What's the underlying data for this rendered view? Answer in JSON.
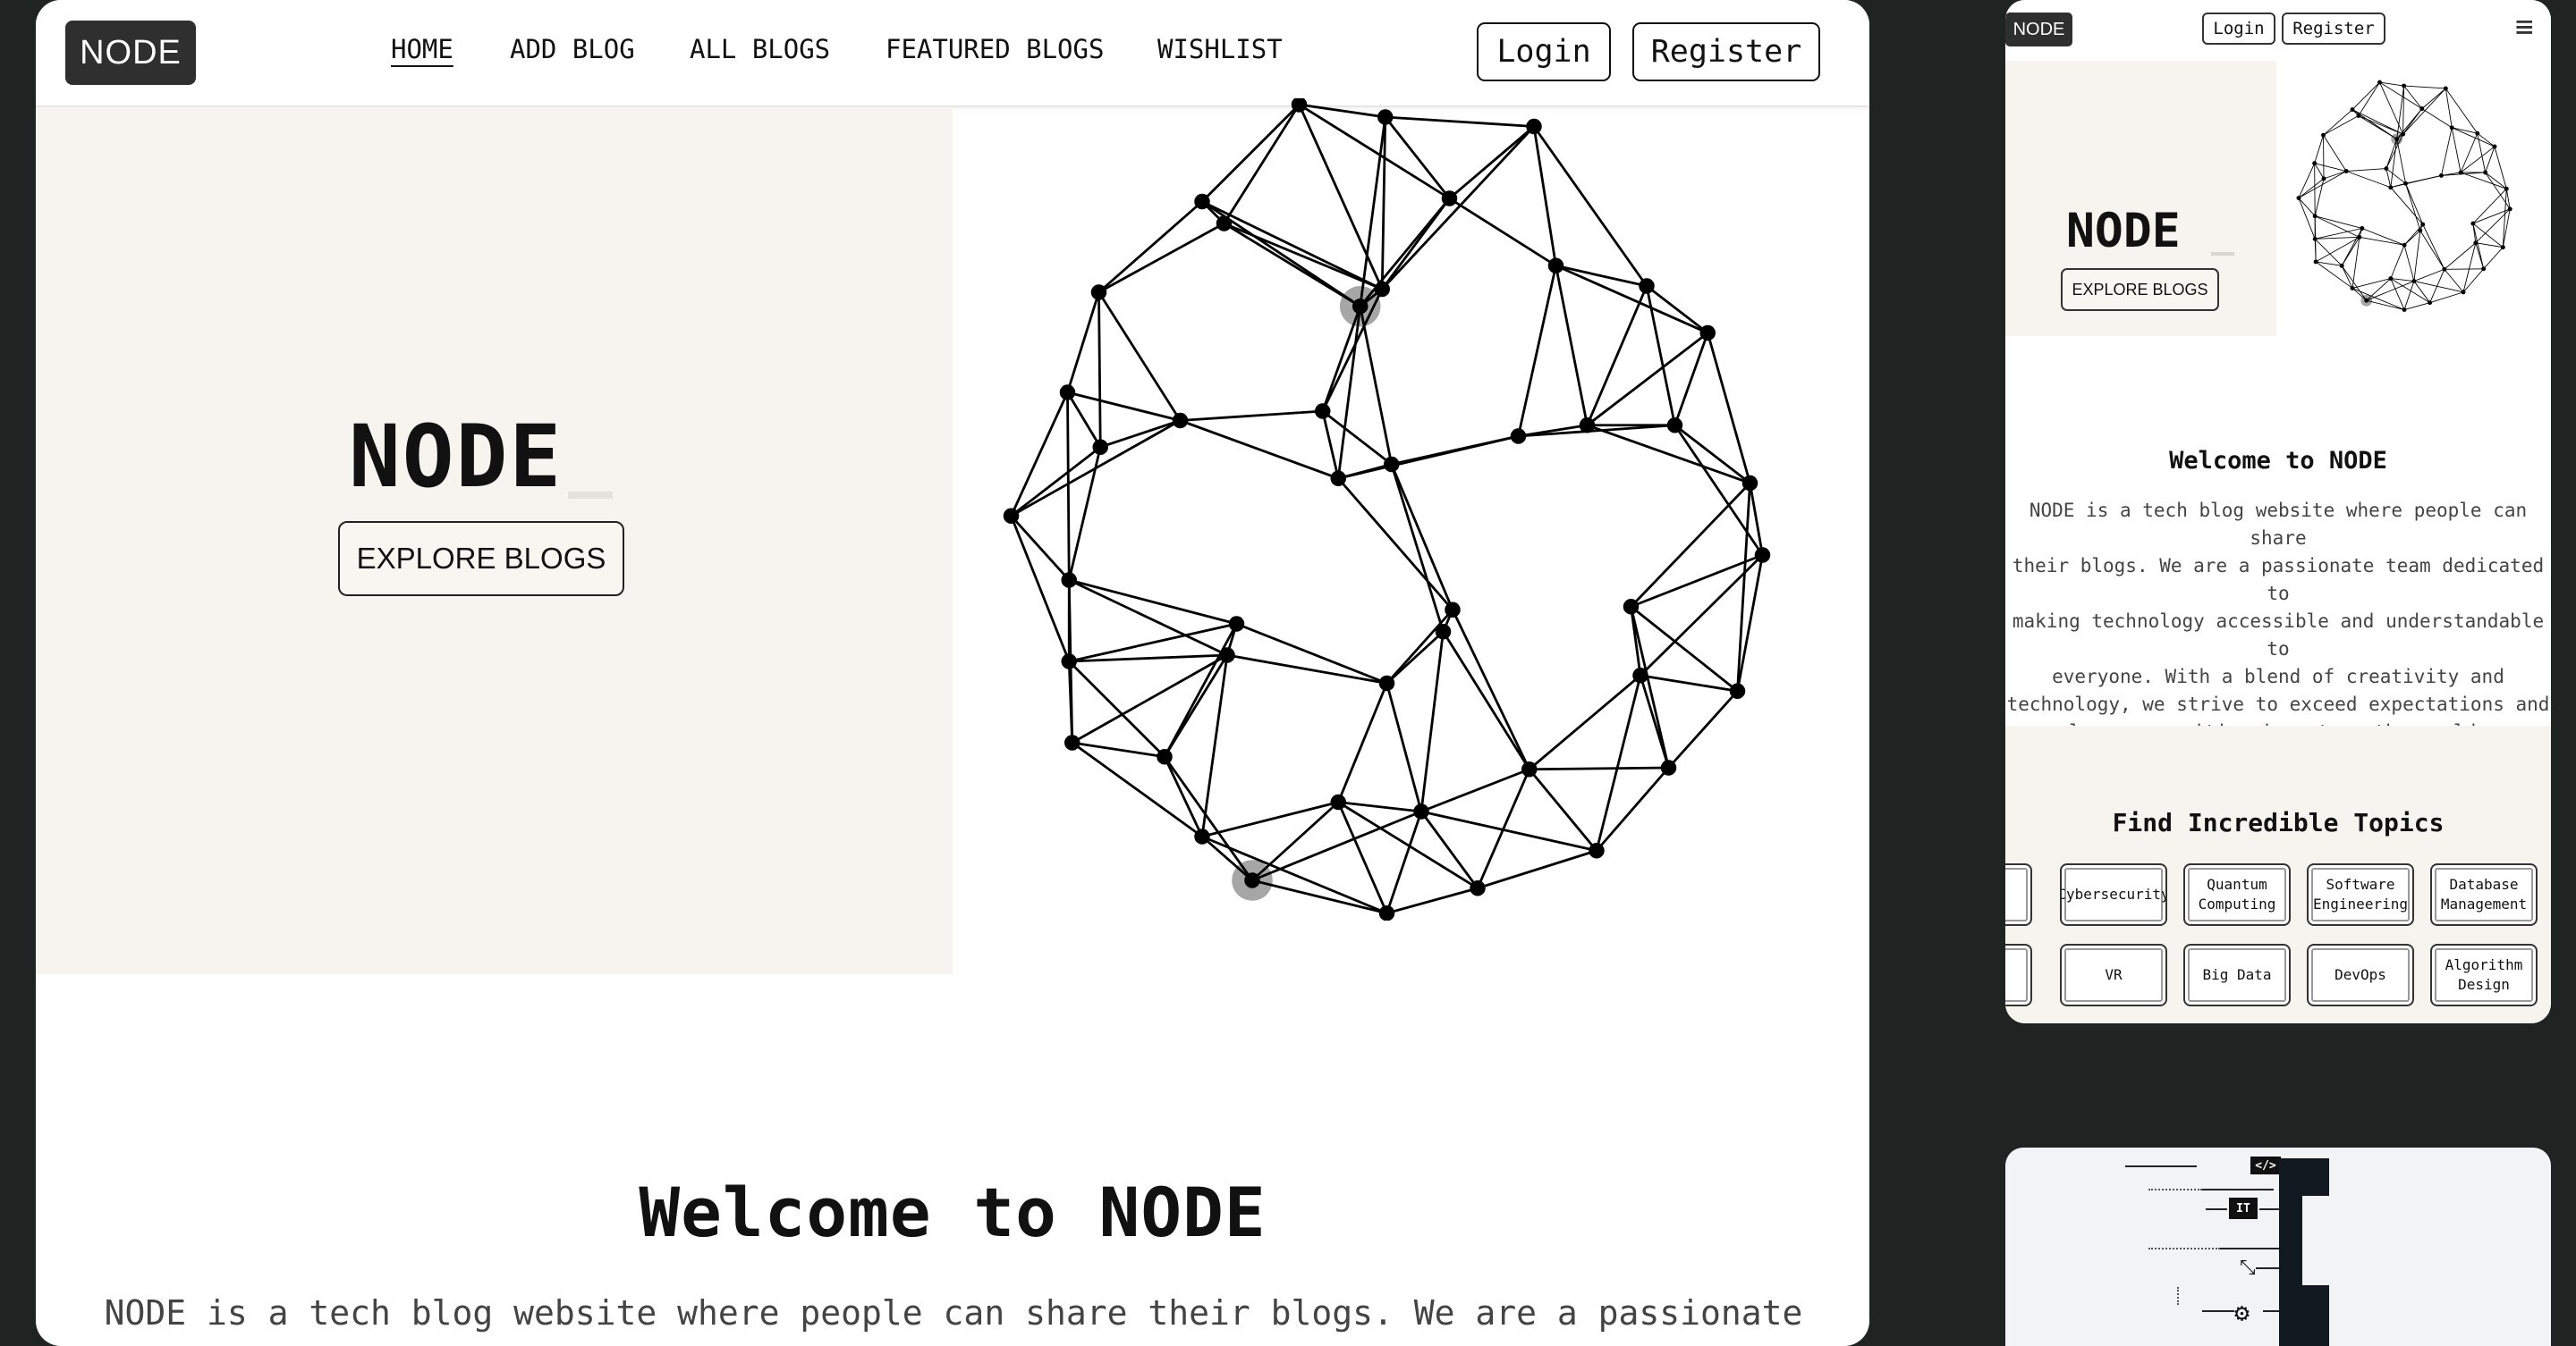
{
  "desktop": {
    "nav": {
      "logo": "NODE",
      "links": [
        "HOME",
        "ADD BLOG",
        "ALL BLOGS",
        "FEATURED BLOGS",
        "WISHLIST"
      ],
      "active_link": "HOME",
      "login_label": "Login",
      "register_label": "Register"
    },
    "hero": {
      "title": "NODE",
      "cta_label": "EXPLORE BLOGS",
      "illustration": "wireframe-sphere-network"
    },
    "welcome": {
      "title": "Welcome to NODE",
      "body": "NODE is a tech blog website where people can share their blogs. We are a passionate team"
    }
  },
  "mobile": {
    "nav": {
      "logo": "NODE",
      "login_label": "Login",
      "register_label": "Register",
      "menu_icon": "hamburger-icon"
    },
    "hero": {
      "title": "NODE",
      "cta_label": "EXPLORE BLOGS"
    },
    "welcome": {
      "title": "Welcome to NODE",
      "body_lines": [
        "NODE is a tech blog website where people can share",
        "their blogs. We are a passionate team dedicated to",
        "making technology accessible and understandable to",
        "everyone. With a blend of creativity and",
        "technology, we strive to exceed expectations and",
        "leave a positive impact on the world."
      ]
    },
    "topics": {
      "title": "Find Incredible Topics",
      "row1": [
        "Cybersecurity",
        "Quantum Computing",
        "Software Engineering",
        "Database Management"
      ],
      "row2": [
        "VR",
        "Big Data",
        "DevOps",
        "Algorithm Design"
      ]
    }
  },
  "preview": {
    "chips": [
      "</>",
      "IT"
    ],
    "icons": [
      "code-icon",
      "it-icon",
      "connection-icon",
      "chip-icon"
    ]
  },
  "colors": {
    "page_background": "#1f2322",
    "hero_panel": "#f5f4ef",
    "logo_background": "#2f2f2f",
    "text": "#111111"
  }
}
